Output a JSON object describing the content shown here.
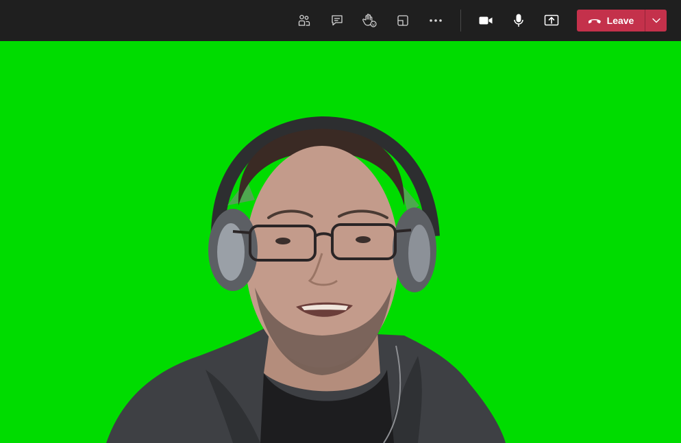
{
  "toolbar": {
    "background": "#1f1f1f",
    "icons": {
      "participants": "people-icon",
      "chat": "chat-icon",
      "reactions": "raise-hand-icon",
      "rooms": "breakout-rooms-icon",
      "more": "more-actions-icon",
      "camera": "video-camera-icon",
      "mic": "microphone-icon",
      "share": "share-screen-icon",
      "hangup": "hang-up-icon",
      "chevron": "chevron-down-icon"
    },
    "leave": {
      "label": "Leave",
      "color": "#c4314b"
    }
  },
  "video": {
    "background_color": "#00dc00",
    "subject": "person-with-headphones"
  }
}
